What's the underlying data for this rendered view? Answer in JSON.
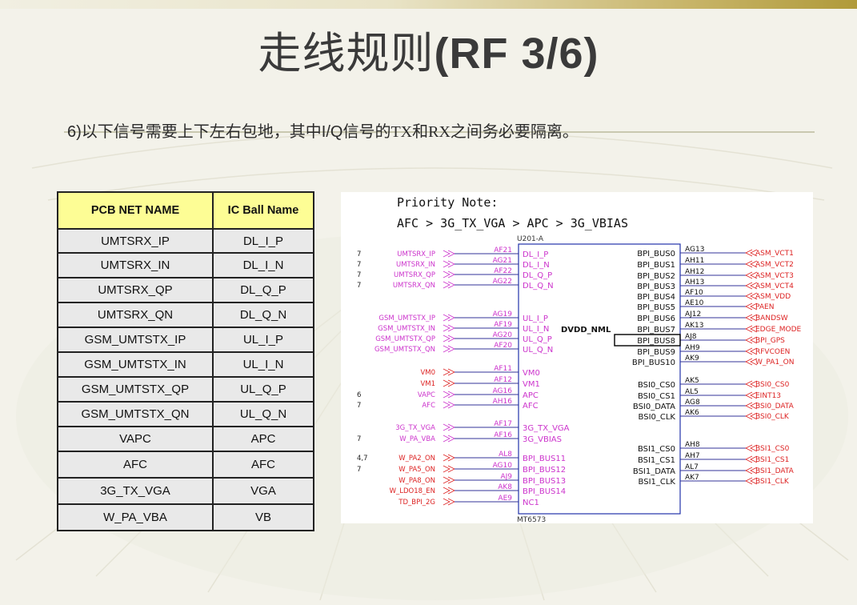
{
  "slide": {
    "title_cn": "走线规则",
    "title_en": "(RF 3/6)",
    "subtitle_prefix": "6)",
    "subtitle_a": "以下信号需要上下左右包地，其中",
    "subtitle_b": "I/Q",
    "subtitle_c": "信号的TX和RX之间务必要隔离。"
  },
  "table": {
    "headers": [
      "PCB  NET NAME",
      "IC Ball Name"
    ],
    "rows": [
      [
        "UMTSRX_IP",
        "DL_I_P"
      ],
      [
        "UMTSRX_IN",
        "DL_I_N"
      ],
      [
        "UMTSRX_QP",
        "DL_Q_P"
      ],
      [
        "UMTSRX_QN",
        "DL_Q_N"
      ],
      [
        "GSM_UMTSTX_IP",
        "UL_I_P"
      ],
      [
        "GSM_UMTSTX_IN",
        "UL_I_N"
      ],
      [
        "GSM_UMTSTX_QP",
        "UL_Q_P"
      ],
      [
        "GSM_UMTSTX_QN",
        "UL_Q_N"
      ],
      [
        "VAPC",
        "APC"
      ],
      [
        "AFC",
        "AFC"
      ],
      [
        "3G_TX_VGA",
        "VGA"
      ],
      [
        "W_PA_VBA",
        "VB"
      ]
    ]
  },
  "schematic": {
    "note_title": "Priority Note:",
    "note_order": "AFC > 3G_TX_VGA > APC > 3G_VBIAS",
    "chip_ref": "U201-A",
    "chip_part": "MT6573",
    "center_label": "DVDD_NML",
    "colors": {
      "net_left_magenta": "#cc33cc",
      "net_red": "#dd2222",
      "wire": "#333399",
      "box": "#2233aa"
    },
    "left_pins": [
      {
        "page": "7",
        "net": "UMTSRX_IP",
        "ball": "AF21",
        "pin": "DL_I_P",
        "color": "magenta"
      },
      {
        "page": "7",
        "net": "UMTSRX_IN",
        "ball": "AG21",
        "pin": "DL_I_N",
        "color": "magenta"
      },
      {
        "page": "7",
        "net": "UMTSRX_QP",
        "ball": "AF22",
        "pin": "DL_Q_P",
        "color": "magenta"
      },
      {
        "page": "7",
        "net": "UMTSRX_QN",
        "ball": "AG22",
        "pin": "DL_Q_N",
        "color": "magenta"
      },
      {
        "page": "",
        "net": "GSM_UMTSTX_IP",
        "ball": "AG19",
        "pin": "UL_I_P",
        "color": "magenta"
      },
      {
        "page": "",
        "net": "GSM_UMTSTX_IN",
        "ball": "AF19",
        "pin": "UL_I_N",
        "color": "magenta"
      },
      {
        "page": "",
        "net": "GSM_UMTSTX_QP",
        "ball": "AG20",
        "pin": "UL_Q_P",
        "color": "magenta"
      },
      {
        "page": "",
        "net": "GSM_UMTSTX_QN",
        "ball": "AF20",
        "pin": "UL_Q_N",
        "color": "magenta"
      },
      {
        "page": "",
        "net": "VM0",
        "ball": "AF11",
        "pin": "VM0",
        "color": "red"
      },
      {
        "page": "",
        "net": "VM1",
        "ball": "AF12",
        "pin": "VM1",
        "color": "red"
      },
      {
        "page": "6",
        "net": "VAPC",
        "ball": "AG16",
        "pin": "APC",
        "color": "magenta"
      },
      {
        "page": "7",
        "net": "AFC",
        "ball": "AH16",
        "pin": "AFC",
        "color": "magenta"
      },
      {
        "page": "",
        "net": "3G_TX_VGA",
        "ball": "AF17",
        "pin": "3G_TX_VGA",
        "color": "magenta"
      },
      {
        "page": "7",
        "net": "W_PA_VBA",
        "ball": "AF16",
        "pin": "3G_VBIAS",
        "color": "magenta"
      },
      {
        "page": "4,7",
        "net": "W_PA2_ON",
        "ball": "AL8",
        "pin": "BPI_BUS11",
        "color": "red"
      },
      {
        "page": "7",
        "net": "W_PA5_ON",
        "ball": "AG10",
        "pin": "BPI_BUS12",
        "color": "red"
      },
      {
        "page": "",
        "net": "W_PA8_ON",
        "ball": "AJ9",
        "pin": "BPI_BUS13",
        "color": "red"
      },
      {
        "page": "",
        "net": "W_LDO18_EN",
        "ball": "AK8",
        "pin": "BPI_BUS14",
        "color": "red"
      },
      {
        "page": "",
        "net": "TD_BPI_2G",
        "ball": "AE9",
        "pin": "NC1",
        "color": "red"
      }
    ],
    "right_pins": [
      {
        "pin": "BPI_BUS0",
        "ball": "AG13",
        "net": "ASM_VCT1"
      },
      {
        "pin": "BPI_BUS1",
        "ball": "AH11",
        "net": "ASM_VCT2"
      },
      {
        "pin": "BPI_BUS2",
        "ball": "AH12",
        "net": "ASM_VCT3"
      },
      {
        "pin": "BPI_BUS3",
        "ball": "AH13",
        "net": "ASM_VCT4"
      },
      {
        "pin": "BPI_BUS4",
        "ball": "AF10",
        "net": "ASM_VDD"
      },
      {
        "pin": "BPI_BUS5",
        "ball": "AE10",
        "net": "PAEN"
      },
      {
        "pin": "BPI_BUS6",
        "ball": "AJ12",
        "net": "BANDSW"
      },
      {
        "pin": "BPI_BUS7",
        "ball": "AK13",
        "net": "EDGE_MODE"
      },
      {
        "pin": "BPI_BUS8",
        "ball": "AJ8",
        "net": "BPI_GPS"
      },
      {
        "pin": "BPI_BUS9",
        "ball": "AH9",
        "net": "RFVCOEN"
      },
      {
        "pin": "BPI_BUS10",
        "ball": "AK9",
        "net": "W_PA1_ON"
      },
      {
        "pin": "BSI0_CS0",
        "ball": "AK5",
        "net": "BSI0_CS0"
      },
      {
        "pin": "BSI0_CS1",
        "ball": "AL5",
        "net": "EINT13"
      },
      {
        "pin": "BSI0_DATA",
        "ball": "AG8",
        "net": "BSI0_DATA"
      },
      {
        "pin": "BSI0_CLK",
        "ball": "AK6",
        "net": "BSI0_CLK"
      },
      {
        "pin": "BSI1_CS0",
        "ball": "AH8",
        "net": "BSI1_CS0"
      },
      {
        "pin": "BSI1_CS1",
        "ball": "AH7",
        "net": "BSI1_CS1"
      },
      {
        "pin": "BSI1_DATA",
        "ball": "AL7",
        "net": "BSI1_DATA"
      },
      {
        "pin": "BSI1_CLK",
        "ball": "AK7",
        "net": "BSI1_CLK"
      }
    ]
  }
}
